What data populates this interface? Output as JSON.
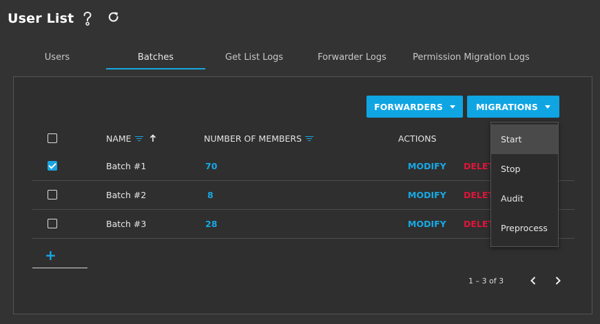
{
  "header": {
    "title": "User List",
    "help_icon": "question-mark-icon",
    "refresh_icon": "refresh-icon"
  },
  "tabs": [
    {
      "label": "Users"
    },
    {
      "label": "Batches",
      "active": true
    },
    {
      "label": "Get List Logs"
    },
    {
      "label": "Forwarder Logs"
    },
    {
      "label": "Permission Migration Logs"
    }
  ],
  "toolbar": {
    "forwarders_label": "FORWARDERS",
    "migrations_label": "MIGRATIONS"
  },
  "table": {
    "columns": {
      "name": "NAME",
      "members": "NUMBER OF MEMBERS",
      "actions": "ACTIONS"
    },
    "sort_icon": "arrow-up-icon",
    "filter_icon": "filter-icon",
    "rows": [
      {
        "name": "Batch #1",
        "members": "70",
        "checked": true,
        "modify": "MODIFY",
        "delete": "DELETE"
      },
      {
        "name": "Batch #2",
        "members": "8",
        "checked": false,
        "modify": "MODIFY",
        "delete": "DELETE"
      },
      {
        "name": "Batch #3",
        "members": "28",
        "checked": false,
        "modify": "MODIFY",
        "delete": "DELETE"
      }
    ]
  },
  "add_button": {
    "label": "+"
  },
  "pagination": {
    "range": "1 – 3 of 3",
    "prev_icon": "chevron-left-icon",
    "next_icon": "chevron-right-icon"
  },
  "migrations_menu": {
    "items": [
      {
        "label": "Start",
        "highlighted": true
      },
      {
        "label": "Stop"
      },
      {
        "label": "Audit"
      },
      {
        "label": "Preprocess"
      }
    ]
  },
  "colors": {
    "background": "#333333",
    "accent": "#0fa5e3",
    "danger": "#e0153a",
    "text": "#e8e8e8"
  }
}
